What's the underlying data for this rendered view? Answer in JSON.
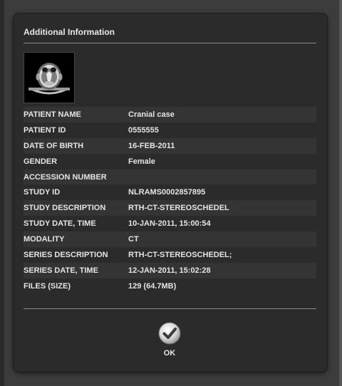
{
  "dialog": {
    "title": "Additional Information",
    "thumbnail_icon": "ct-scan-thumbnail"
  },
  "fields": [
    {
      "label": "PATIENT NAME",
      "value": "Cranial case"
    },
    {
      "label": "PATIENT ID",
      "value": "0555555"
    },
    {
      "label": "DATE OF BIRTH",
      "value": "16-FEB-2011"
    },
    {
      "label": "GENDER",
      "value": "Female"
    },
    {
      "label": "ACCESSION NUMBER",
      "value": ""
    },
    {
      "label": "STUDY ID",
      "value": "NLRAMS0002857895"
    },
    {
      "label": "STUDY DESCRIPTION",
      "value": "RTH-CT-STEREOSCHEDEL"
    },
    {
      "label": "STUDY DATE, TIME",
      "value": "10-JAN-2011, 15:00:54"
    },
    {
      "label": "MODALITY",
      "value": "CT"
    },
    {
      "label": "SERIES DESCRIPTION",
      "value": "RTH-CT-STEREOSCHEDEL;"
    },
    {
      "label": "SERIES DATE, TIME",
      "value": "12-JAN-2011, 15:02:28"
    },
    {
      "label": "FILES (SIZE)",
      "value": "129 (64.7MB)"
    }
  ],
  "ok_button": {
    "label": "OK",
    "icon": "checkmark-icon"
  },
  "colors": {
    "dialog_bg": "#2b2b2b",
    "row_alt_bg": "#343434",
    "text": "#e4e4e4"
  }
}
